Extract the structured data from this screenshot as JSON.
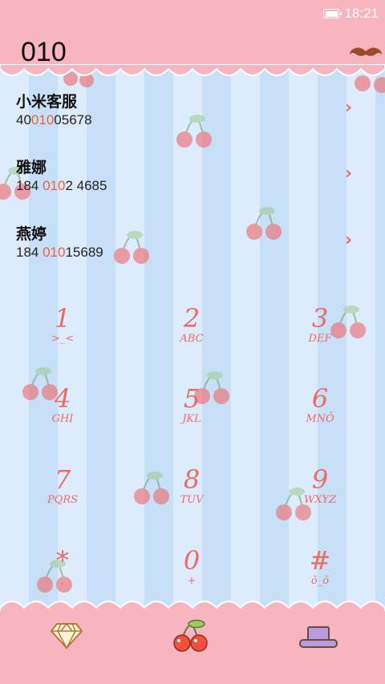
{
  "status_bar": {
    "time": "18:21",
    "battery_icon": "battery-icon"
  },
  "header": {
    "dialed_number": "010",
    "menu_icon": "mustache-icon"
  },
  "results": [
    {
      "name": "小米客服",
      "number_parts": [
        "40",
        "010",
        "05678"
      ]
    },
    {
      "name": "雅娜",
      "number_parts": [
        "184 ",
        "010",
        "2 4685"
      ]
    },
    {
      "name": "燕婷",
      "number_parts": [
        "184 ",
        "010",
        "15689"
      ]
    }
  ],
  "keypad": [
    {
      "digit": "1",
      "letters": ">_<"
    },
    {
      "digit": "2",
      "letters": "ABC"
    },
    {
      "digit": "3",
      "letters": "DEF"
    },
    {
      "digit": "4",
      "letters": "GHI"
    },
    {
      "digit": "5",
      "letters": "JKL"
    },
    {
      "digit": "6",
      "letters": "MNŎ"
    },
    {
      "digit": "7",
      "letters": "PQRS"
    },
    {
      "digit": "8",
      "letters": "TUV"
    },
    {
      "digit": "9",
      "letters": "WXYZ"
    },
    {
      "digit": "*",
      "letters": ","
    },
    {
      "digit": "0",
      "letters": "+"
    },
    {
      "digit": "#",
      "letters": "ŏ_ŏ"
    }
  ],
  "bottom_bar": {
    "left_icon": "diamond-icon",
    "center_icon": "cherry-icon",
    "right_icon": "hat-icon"
  },
  "colors": {
    "pink": "#f7b5c0",
    "accent": "#ec6b66",
    "highlight": "#e8623a",
    "stripe_light": "#dcecfc",
    "stripe_dark": "#c7e0f8"
  }
}
